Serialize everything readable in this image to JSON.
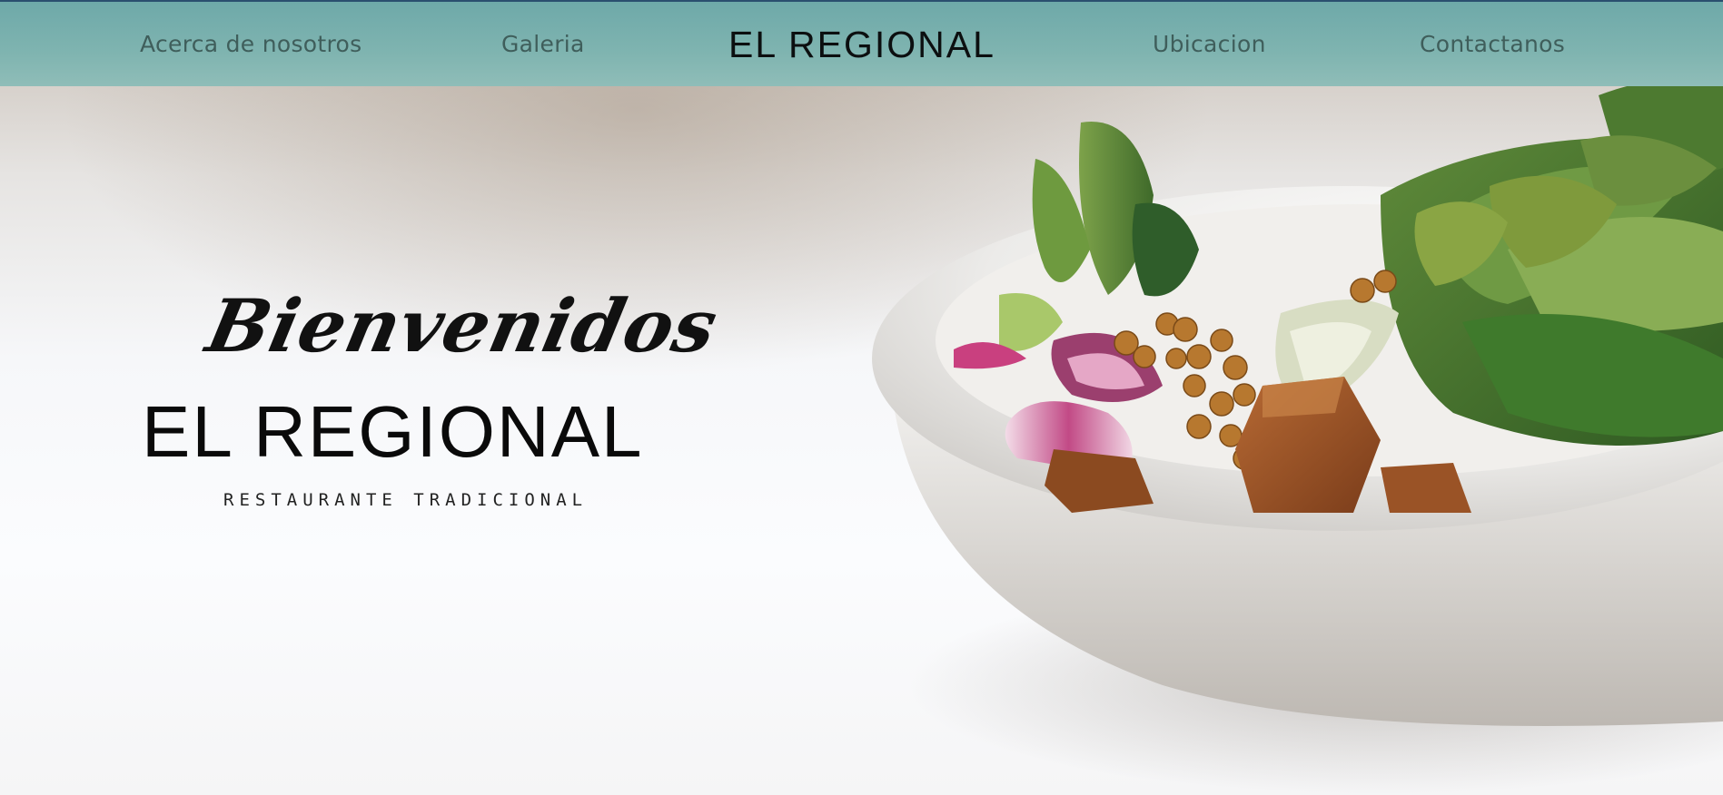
{
  "nav": {
    "about_label": "Acerca de nosotros",
    "gallery_label": "Galeria",
    "brand_label": "EL REGIONAL",
    "location_label": "Ubicacion",
    "contact_label": "Contactanos"
  },
  "hero": {
    "greeting": "Bienvenidos",
    "title": "EL REGIONAL",
    "subtitle": "RESTAURANTE TRADICIONAL",
    "image_icon": "salad-bowl-image"
  },
  "colors": {
    "navbar": "#7fb4b0",
    "nav_text": "#3f5e5b",
    "brand_text": "#0c0f10",
    "border_top": "#2a4f6f"
  }
}
